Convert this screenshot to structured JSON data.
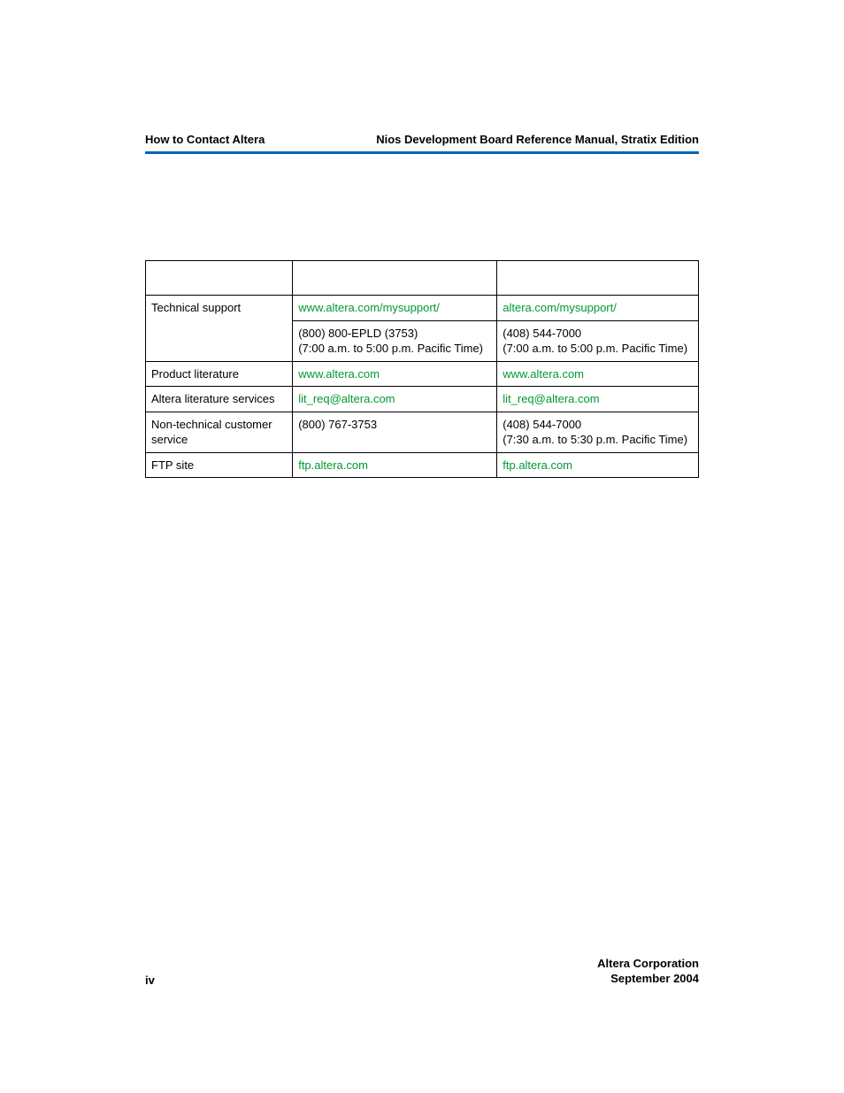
{
  "header": {
    "left": "How to Contact Altera",
    "right": "Nios Development Board Reference Manual, Stratix Edition"
  },
  "table": {
    "rows": [
      {
        "c1": "Technical support",
        "c2_link": "www.altera.com/mysupport/",
        "c3_link": "altera.com/mysupport/"
      },
      {
        "c2a": "(800) 800-EPLD (3753)",
        "c2b": "(7:00 a.m. to 5:00 p.m. Pacific Time)",
        "c3a": "(408) 544-7000",
        "c3b": "(7:00 a.m. to 5:00 p.m. Pacific Time)"
      },
      {
        "c1": "Product literature",
        "c2_link": "www.altera.com",
        "c3_link": "www.altera.com"
      },
      {
        "c1": "Altera literature services",
        "c2_link": "lit_req@altera.com",
        "c3_link": "lit_req@altera.com"
      },
      {
        "c1a": "Non-technical customer",
        "c1b": "service",
        "c2": "(800) 767-3753",
        "c3a": "(408) 544-7000",
        "c3b": "(7:30 a.m. to 5:30 p.m. Pacific Time)"
      },
      {
        "c1": "FTP site",
        "c2_link": "ftp.altera.com",
        "c3_link": "ftp.altera.com"
      }
    ]
  },
  "footer": {
    "page": "iv",
    "right1": "Altera Corporation",
    "right2": "September 2004"
  }
}
